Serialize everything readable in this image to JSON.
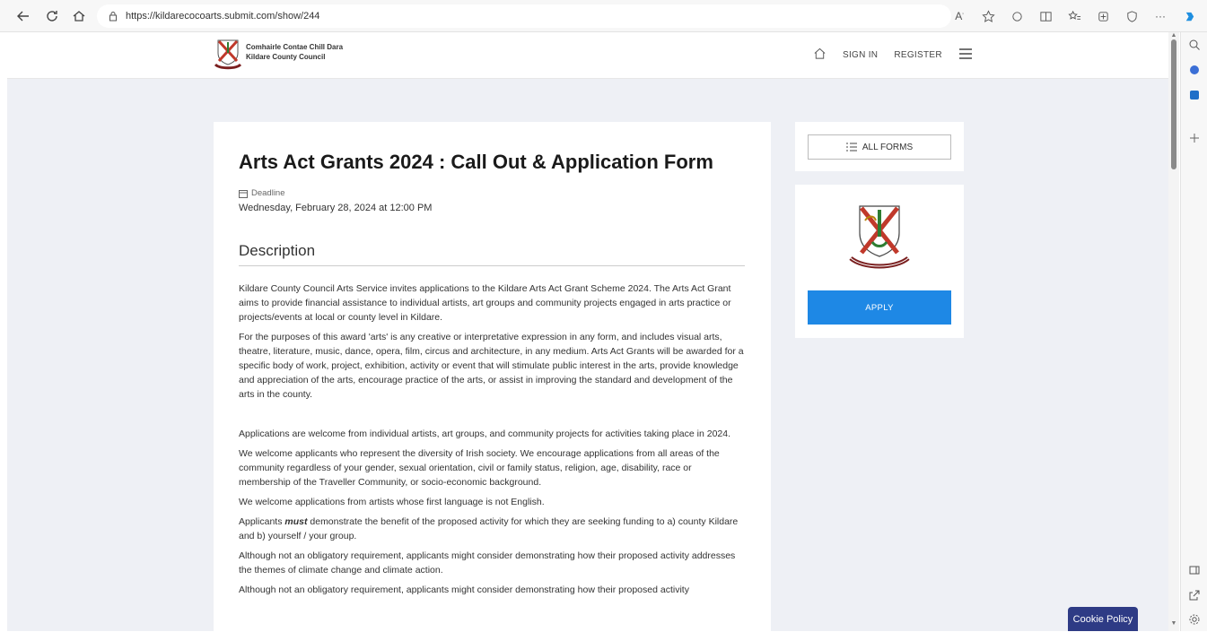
{
  "browser": {
    "url": "https://kildarecocoarts.submit.com/show/244"
  },
  "site": {
    "logo_line1": "Comhairle Contae Chill Dara",
    "logo_line2": "Kildare County Council",
    "nav_signin": "SIGN IN",
    "nav_register": "REGISTER"
  },
  "form": {
    "title": "Arts Act Grants 2024 : Call Out & Application Form",
    "deadline_label": "Deadline",
    "deadline_value": "Wednesday, February 28, 2024 at 12:00 PM",
    "description_heading": "Description",
    "p1": "Kildare County Council Arts Service invites applications to the Kildare Arts Act Grant Scheme 2024. The Arts Act Grant aims to provide financial assistance to individual artists, art groups and community projects engaged in arts practice or projects/events at local or county level in Kildare.",
    "p2": "For the purposes of this award 'arts' is any creative or interpretative expression in any form, and includes visual arts, theatre, literature, music, dance, opera, film, circus and architecture, in any medium. Arts Act Grants will be awarded for a specific body of work, project, exhibition, activity or event that will stimulate public interest in the arts, provide knowledge and appreciation of the arts, encourage practice of the arts, or assist in improving the standard and development of the arts in the county.",
    "p3": "Applications are welcome from individual artists, art groups, and community projects for activities taking place in 2024.",
    "p4": "We welcome applicants who represent the diversity of Irish society. We encourage applications from all areas of the community regardless of your gender, sexual orientation, civil or family status, religion, age, disability, race or membership of the Traveller Community, or socio-economic background.",
    "p5": "We welcome applications from artists whose first language is not English.",
    "p6_before": "Applicants ",
    "p6_emph": "must",
    "p6_after": " demonstrate the benefit of the proposed activity for which they are seeking funding to a) county Kildare and b) yourself / your group.",
    "p7": "Although not an obligatory requirement, applicants might consider demonstrating how their proposed activity addresses the themes of climate change and climate action.",
    "p8": "Although not an obligatory requirement, applicants might consider demonstrating how their proposed activity"
  },
  "sidebar": {
    "all_forms_label": "ALL FORMS",
    "apply_label": "APPLY"
  },
  "cookie": {
    "label": "Cookie Policy"
  },
  "colors": {
    "apply_blue": "#1e88e5",
    "cookie_navy": "#2e3b85",
    "page_bg": "#eef0f5"
  }
}
